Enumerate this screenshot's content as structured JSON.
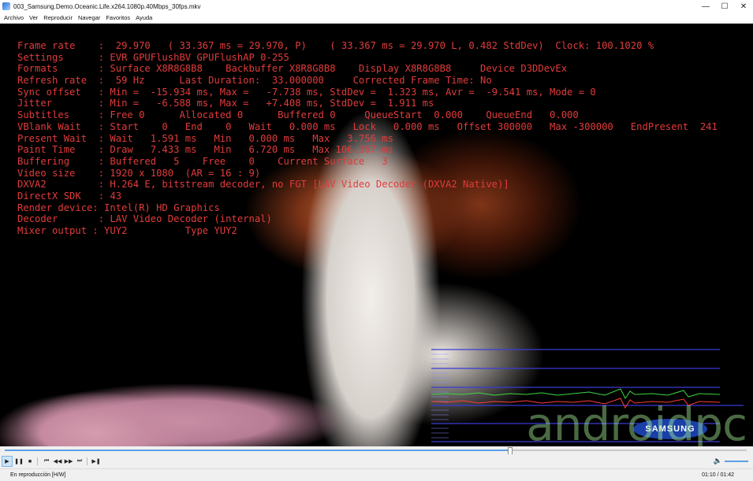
{
  "window": {
    "title": "003_Samsung.Demo.Oceanic.Life.x264.1080p.40Mbps_30fps.mkv",
    "controls": [
      "—",
      "☐",
      "✕"
    ]
  },
  "menu": [
    "Archivo",
    "Ver",
    "Reproducir",
    "Navegar",
    "Favoritos",
    "Ayuda"
  ],
  "osd": {
    "lines": [
      "Frame rate    :  29.970   ( 33.367 ms = 29.970, P)    ( 33.367 ms = 29.970 L, 0.482 StdDev)  Clock: 100.1020 %",
      "Settings      : EVR GPUFlushBV GPUFlushAP 0-255",
      "Formats       : Surface X8R8G8B8    Backbuffer X8R8G8B8    Display X8R8G8B8     Device D3DDevEx",
      "Refresh rate  :  59 Hz      Last Duration:  33.000000     Corrected Frame Time: No",
      "Sync offset   : Min =  -15.934 ms, Max =   -7.738 ms, StdDev =  1.323 ms, Avr =  -9.541 ms, Mode = 0",
      "Jitter        : Min =   -6.588 ms, Max =   +7.408 ms, StdDev =  1.911 ms",
      "Subtitles     : Free 0      Allocated 0      Buffered 0     QueueStart  0.000    QueueEnd   0.000",
      "VBlank Wait   : Start    0   End    0   Wait   0.000 ms   Lock   0.000 ms   Offset 300000   Max -300000   EndPresent  241",
      "Present Wait  : Wait   1.591 ms   Min   0.000 ms   Max   3.756 ms",
      "Paint Time    : Draw   7.433 ms   Min   6.720 ms   Max 106.367 ms",
      "Buffering     : Buffered   5    Free    0    Current Surface   3",
      "Video size    : 1920 x 1080  (AR = 16 : 9)",
      "DXVA2         : H.264 E, bitstream decoder, no FGT [LAV Video Decoder (DXVA2 Native)]",
      "DirectX SDK   : 43",
      "Render device: Intel(R) HD Graphics",
      "Decoder       : LAV Video Decoder (internal)",
      "Mixer output : YUY2          Type YUY2"
    ]
  },
  "overlay": {
    "brand_logo_text": "SAMSUNG",
    "watermark": "androidpc"
  },
  "player": {
    "seek_progress": 0.68,
    "volume": 1.0,
    "buttons": [
      {
        "name": "play-button",
        "glyph": "▶",
        "active": true
      },
      {
        "name": "pause-button",
        "glyph": "❚❚",
        "active": false
      },
      {
        "name": "stop-button",
        "glyph": "■",
        "active": false
      },
      {
        "sep": true
      },
      {
        "name": "previous-button",
        "glyph": "⏮",
        "active": false
      },
      {
        "name": "rewind-button",
        "glyph": "◀◀",
        "active": false
      },
      {
        "name": "forward-button",
        "glyph": "▶▶",
        "active": false
      },
      {
        "name": "next-button",
        "glyph": "⏭",
        "active": false
      },
      {
        "sep": true
      },
      {
        "name": "frame-step-button",
        "glyph": "▶❚",
        "active": false
      }
    ]
  },
  "status": {
    "text": "En reproducción [H/W]",
    "time": "01:10 / 01:42"
  }
}
